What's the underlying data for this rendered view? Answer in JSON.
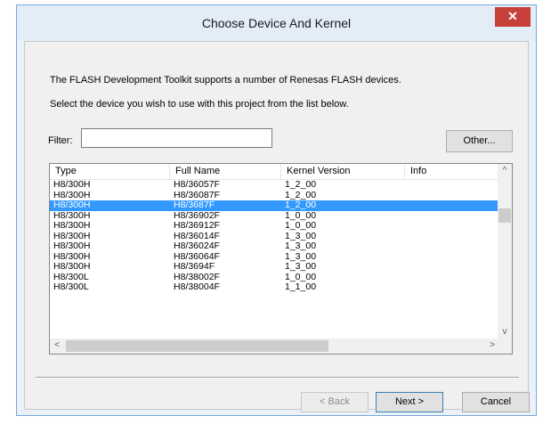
{
  "window": {
    "title": "Choose Device And Kernel",
    "close_label": "✕"
  },
  "intro": {
    "line1": "The FLASH Development Toolkit supports a number of Renesas FLASH devices.",
    "line2": "Select the device you wish to use with this project from the list below."
  },
  "filter": {
    "label": "Filter:",
    "value": ""
  },
  "buttons": {
    "other": "Other...",
    "back": "< Back",
    "next": "Next >",
    "cancel": "Cancel"
  },
  "table": {
    "columns": [
      "Type",
      "Full Name",
      "Kernel Version",
      "Info"
    ],
    "selected_index": 2,
    "rows": [
      {
        "type": "H8/300H",
        "full_name": "H8/36057F",
        "kernel": "1_2_00",
        "info": ""
      },
      {
        "type": "H8/300H",
        "full_name": "H8/36087F",
        "kernel": "1_2_00",
        "info": ""
      },
      {
        "type": "H8/300H",
        "full_name": "H8/3687F",
        "kernel": "1_2_00",
        "info": ""
      },
      {
        "type": "H8/300H",
        "full_name": "H8/36902F",
        "kernel": "1_0_00",
        "info": ""
      },
      {
        "type": "H8/300H",
        "full_name": "H8/36912F",
        "kernel": "1_0_00",
        "info": ""
      },
      {
        "type": "H8/300H",
        "full_name": "H8/36014F",
        "kernel": "1_3_00",
        "info": ""
      },
      {
        "type": "H8/300H",
        "full_name": "H8/36024F",
        "kernel": "1_3_00",
        "info": ""
      },
      {
        "type": "H8/300H",
        "full_name": "H8/36064F",
        "kernel": "1_3_00",
        "info": ""
      },
      {
        "type": "H8/300H",
        "full_name": "H8/3694F",
        "kernel": "1_3_00",
        "info": ""
      },
      {
        "type": "H8/300L",
        "full_name": "H8/38002F",
        "kernel": "1_0_00",
        "info": ""
      },
      {
        "type": "H8/300L",
        "full_name": "H8/38004F",
        "kernel": "1_1_00",
        "info": ""
      }
    ]
  },
  "scroll": {
    "up": "^",
    "down": "v",
    "left": "<",
    "right": ">"
  },
  "colors": {
    "selection": "#3399ff",
    "close_button": "#c7403a"
  }
}
